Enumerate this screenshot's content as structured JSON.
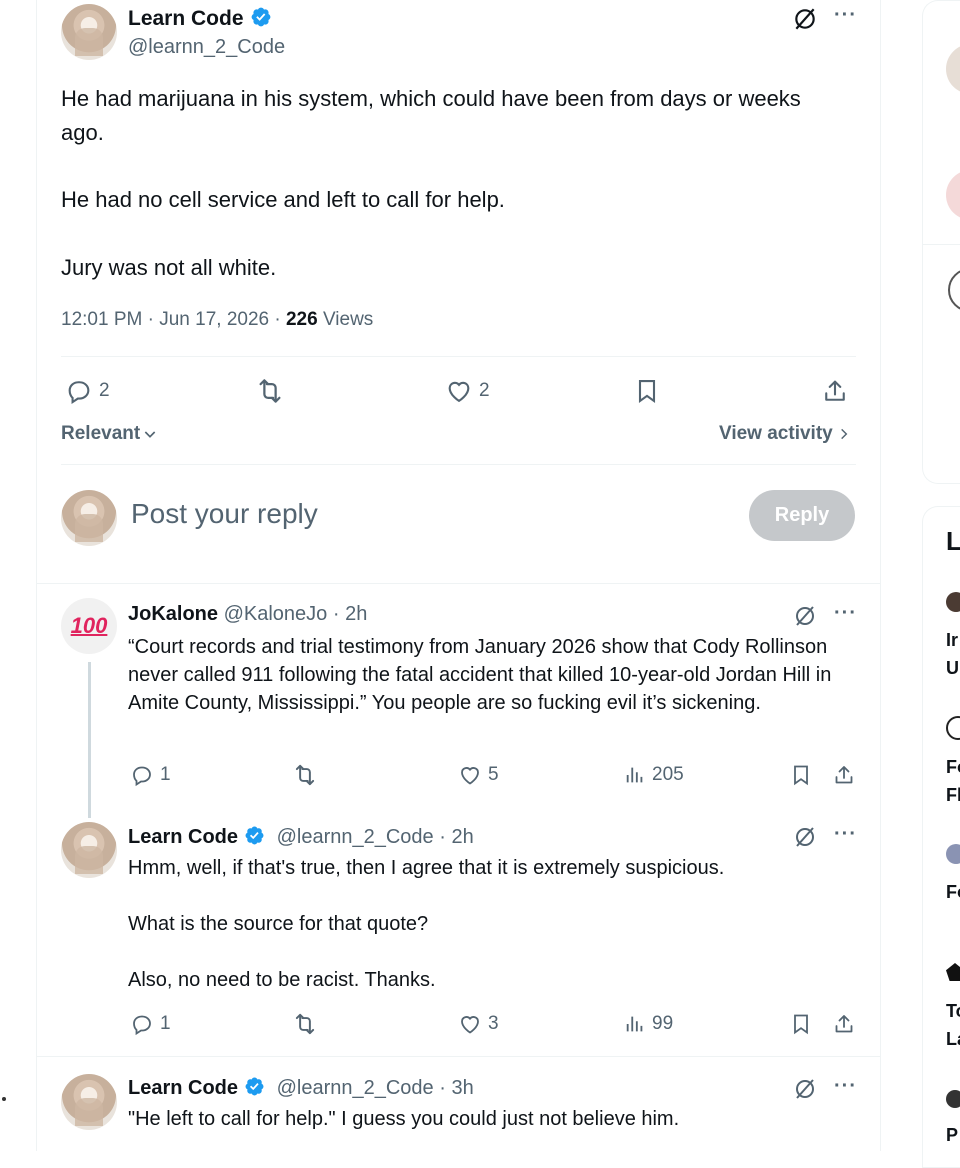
{
  "main_tweet": {
    "author_name": "Learn Code",
    "author_handle": "@learnn_2_Code",
    "body_lines": [
      "He had marijuana in his system, which could have been from days or weeks ago.",
      "He had no cell service and left to call for help.",
      "Jury was not all white."
    ],
    "time": "12:01 PM · Jun 17, 2026 · ",
    "views_count": "226",
    "views_label": " Views",
    "replies": "2",
    "likes": "2",
    "sort_label": "Relevant",
    "view_activity": "View activity"
  },
  "composer": {
    "placeholder": "Post your reply",
    "reply_button": "Reply"
  },
  "replies": [
    {
      "author_name": "JoKalone",
      "meta": "@KaloneJo · 2h",
      "avatar_text": "100",
      "text": "“Court records and trial testimony from January 2026 show that Cody Rollinson never called 911 following the fatal accident that killed 10-year-old Jordan Hill in Amite County, Mississippi.” You people are so fucking evil it’s  sickening.",
      "replies": "1",
      "likes": "5",
      "views": "205"
    },
    {
      "author_name": "Learn Code",
      "meta": "@learnn_2_Code · 2h",
      "text_lines": [
        "Hmm, well, if that's true, then I agree that it is extremely suspicious.",
        "What is the source for that quote?",
        "Also, no need to be racist. Thanks."
      ],
      "replies": "1",
      "likes": "3",
      "views": "99"
    },
    {
      "author_name": "Learn Code",
      "meta": "@learnn_2_Code · 3h",
      "text": "\"He left to call for help.\" I guess you could just not believe him."
    }
  ],
  "right_sidebar": {
    "heading_initial": "L",
    "cut_texts": [
      "Ir",
      "U",
      "Fo",
      "Fl",
      "Fo",
      "To",
      "La",
      "P"
    ]
  },
  "colors": {
    "verified": "#1d9bf0",
    "grey": "#536471",
    "reply_button_disabled": "#c5c8cb",
    "hundred_red": "#e0245e"
  },
  "icons": [
    "verified-icon",
    "grok-icon",
    "more-icon",
    "reply-icon",
    "retweet-icon",
    "like-icon",
    "bookmark-icon",
    "share-icon",
    "views-icon",
    "chevron-down-icon",
    "chevron-right-icon"
  ]
}
